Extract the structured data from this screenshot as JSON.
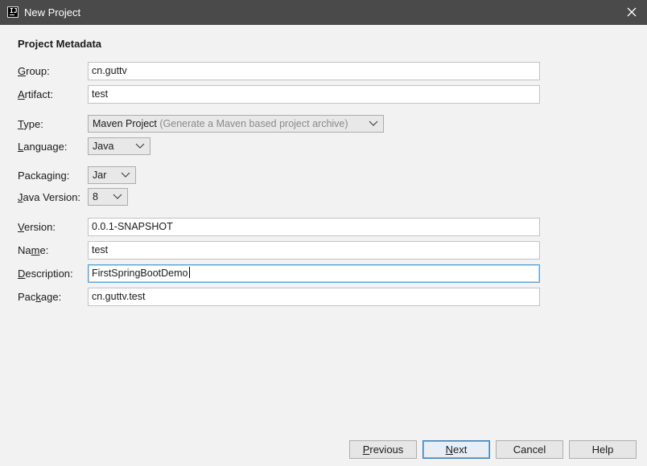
{
  "window": {
    "title": "New Project",
    "app_icon_text": "IJ"
  },
  "section": {
    "title": "Project Metadata"
  },
  "fields": {
    "group": {
      "label_u": "G",
      "label_rest": "roup:",
      "value": "cn.guttv"
    },
    "artifact": {
      "label_u": "A",
      "label_rest": "rtifact:",
      "value": "test"
    },
    "type": {
      "label_u": "T",
      "label_rest": "ype:",
      "value": "Maven Project",
      "hint": "(Generate a Maven based project archive)"
    },
    "language": {
      "label_u": "L",
      "label_rest": "anguage:",
      "value": "Java"
    },
    "packaging": {
      "label_pre": "Packa",
      "label_u": "g",
      "label_rest": "ing:",
      "value": "Jar"
    },
    "java_version": {
      "label_u": "J",
      "label_rest": "ava Version:",
      "value": "8"
    },
    "version": {
      "label_u": "V",
      "label_rest": "ersion:",
      "value": "0.0.1-SNAPSHOT"
    },
    "name": {
      "label_pre": "Na",
      "label_u": "m",
      "label_rest": "e:",
      "value": "test"
    },
    "description": {
      "label_u": "D",
      "label_rest": "escription:",
      "value": "FirstSpringBootDemo"
    },
    "package": {
      "label_pre": "Pac",
      "label_u": "k",
      "label_rest": "age:",
      "value": "cn.guttv.test"
    }
  },
  "buttons": {
    "previous": {
      "label_u": "P",
      "label_rest": "revious"
    },
    "next": {
      "label_u": "N",
      "label_rest": "ext"
    },
    "cancel": {
      "label": "Cancel"
    },
    "help": {
      "label": "Help"
    }
  },
  "icons": {
    "close": "close-icon",
    "dropdown": "chevron-down-icon"
  },
  "colors": {
    "titlebar": "#4a4a4a",
    "background": "#f2f2f2",
    "focus_border": "#5a9fd4",
    "hint_text": "#8a8a8a"
  }
}
